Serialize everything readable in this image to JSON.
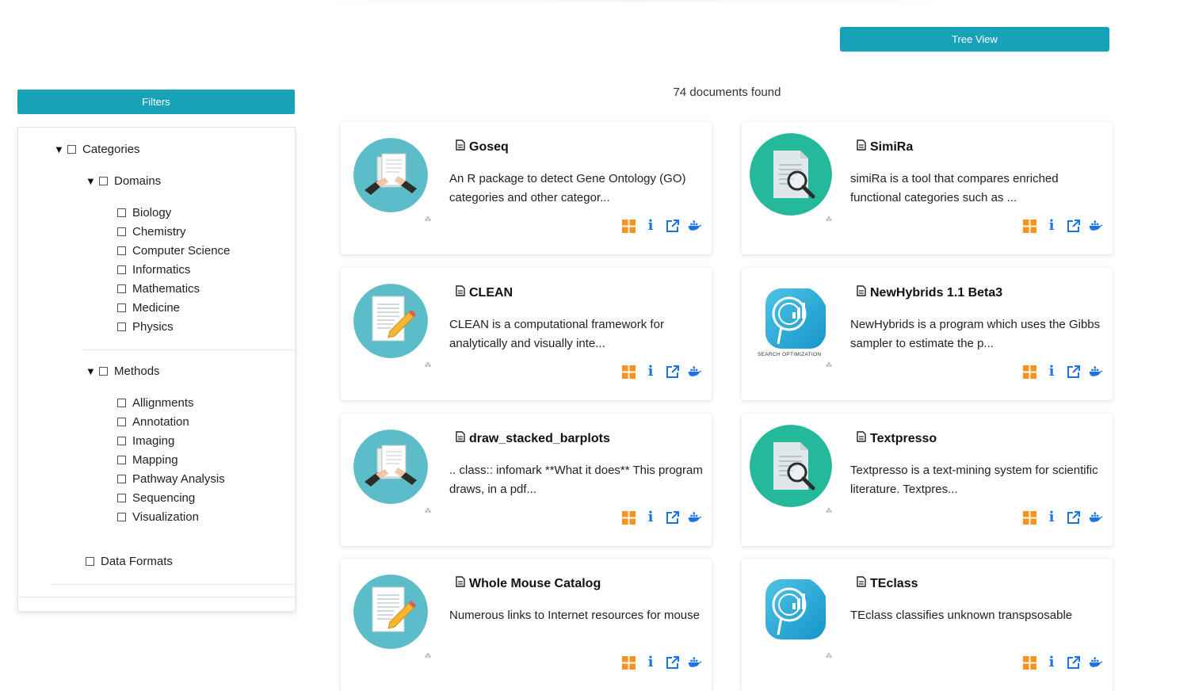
{
  "header": {
    "tree_view_label": "Tree View"
  },
  "filters": {
    "button_label": "Filters",
    "root": "Categories",
    "domains_label": "Domains",
    "domains": [
      "Biology",
      "Chemistry",
      "Computer Science",
      "Informatics",
      "Mathematics",
      "Medicine",
      "Physics"
    ],
    "methods_label": "Methods",
    "methods": [
      "Allignments",
      "Annotation",
      "Imaging",
      "Mapping",
      "Pathway Analysis",
      "Sequencing",
      "Visualization"
    ],
    "data_formats_label": "Data Formats"
  },
  "results": {
    "count_text": "74 documents found",
    "cards": [
      {
        "title": "Goseq",
        "desc": "An R package to detect Gene Ontology (GO) categories and other categor...",
        "thumb": "documents-hand-icon"
      },
      {
        "title": "SimiRa",
        "desc": "simiRa is a tool that compares enriched functional categories such as ...",
        "thumb": "document-magnifier-icon"
      },
      {
        "title": "CLEAN",
        "desc": " CLEAN is a computational framework for analytically and visually inte...",
        "thumb": "document-pencil-icon"
      },
      {
        "title": "NewHybrids 1.1 Beta3",
        "desc": "NewHybrids is a program which uses the Gibbs sampler to estimate the p...",
        "thumb": "search-optimization-icon",
        "thumb_caption": "SEARCH OPTIMIZATION"
      },
      {
        "title": "draw_stacked_barplots",
        "desc": ".. class:: infomark **What it does** This program draws, in a pdf...",
        "thumb": "documents-hand-icon"
      },
      {
        "title": "Textpresso",
        "desc": "Textpresso is a text-mining system for scientific literature. Textpres...",
        "thumb": "document-magnifier-icon"
      },
      {
        "title": "Whole Mouse Catalog",
        "desc": "Numerous links to Internet resources for mouse",
        "thumb": "document-pencil-icon"
      },
      {
        "title": "TEclass",
        "desc": "TEclass classifies unknown transpsosable",
        "thumb": "search-optimization-icon"
      }
    ]
  },
  "colors": {
    "accent": "#17a2b8",
    "grid_icon": "#f7931e",
    "action_blue": "#1a73e8",
    "thumb_teal": "#5cbdc8",
    "thumb_green": "#23b99a"
  }
}
